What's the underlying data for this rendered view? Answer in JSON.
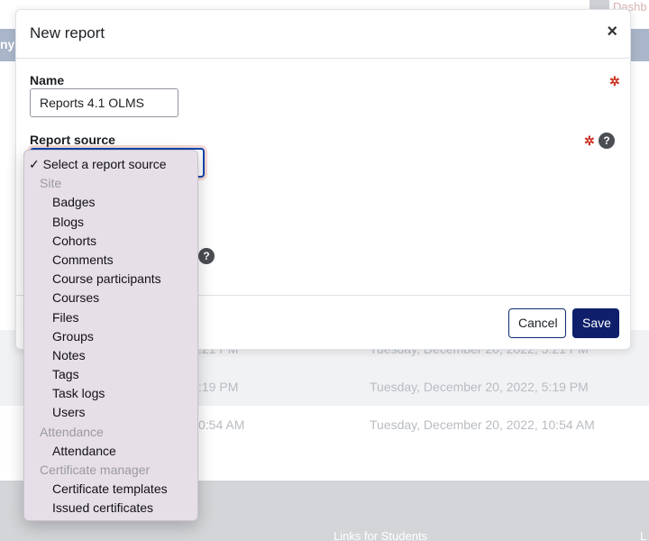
{
  "background": {
    "topbar_link": "Dashb",
    "nav_text": "ny",
    "rows": [
      {
        "c1": ":21 PM",
        "c2": "Tuesday, December 20, 2022, 5:21 PM"
      },
      {
        "c1": ":19 PM",
        "c2": "Tuesday, December 20, 2022, 5:19 PM"
      },
      {
        "c1": "0:54 AM",
        "c2": "Tuesday, December 20, 2022, 10:54 AM"
      }
    ],
    "footer_links": "Links for Students",
    "footer_edge": "L"
  },
  "modal": {
    "title": "New report",
    "close_glyph": "×",
    "name_label": "Name",
    "name_value": "Reports 4.1 OLMS",
    "report_source_label": "Report source",
    "required_glyph": "✲",
    "help_glyph": "?",
    "cancel_label": "Cancel",
    "save_label": "Save"
  },
  "dropdown": {
    "selected": "✓ Select a report source",
    "groups": [
      {
        "label": "Site",
        "items": [
          "Badges",
          "Blogs",
          "Cohorts",
          "Comments",
          "Course participants",
          "Courses",
          "Files",
          "Groups",
          "Notes",
          "Tags",
          "Task logs",
          "Users"
        ]
      },
      {
        "label": "Attendance",
        "items": [
          "Attendance"
        ]
      },
      {
        "label": "Certificate manager",
        "items": [
          "Certificate templates",
          "Issued certificates"
        ]
      }
    ]
  },
  "colors": {
    "primary": "#0f1f6b",
    "required": "#ca3120",
    "dropdown_bg": "#e6dfe8"
  }
}
